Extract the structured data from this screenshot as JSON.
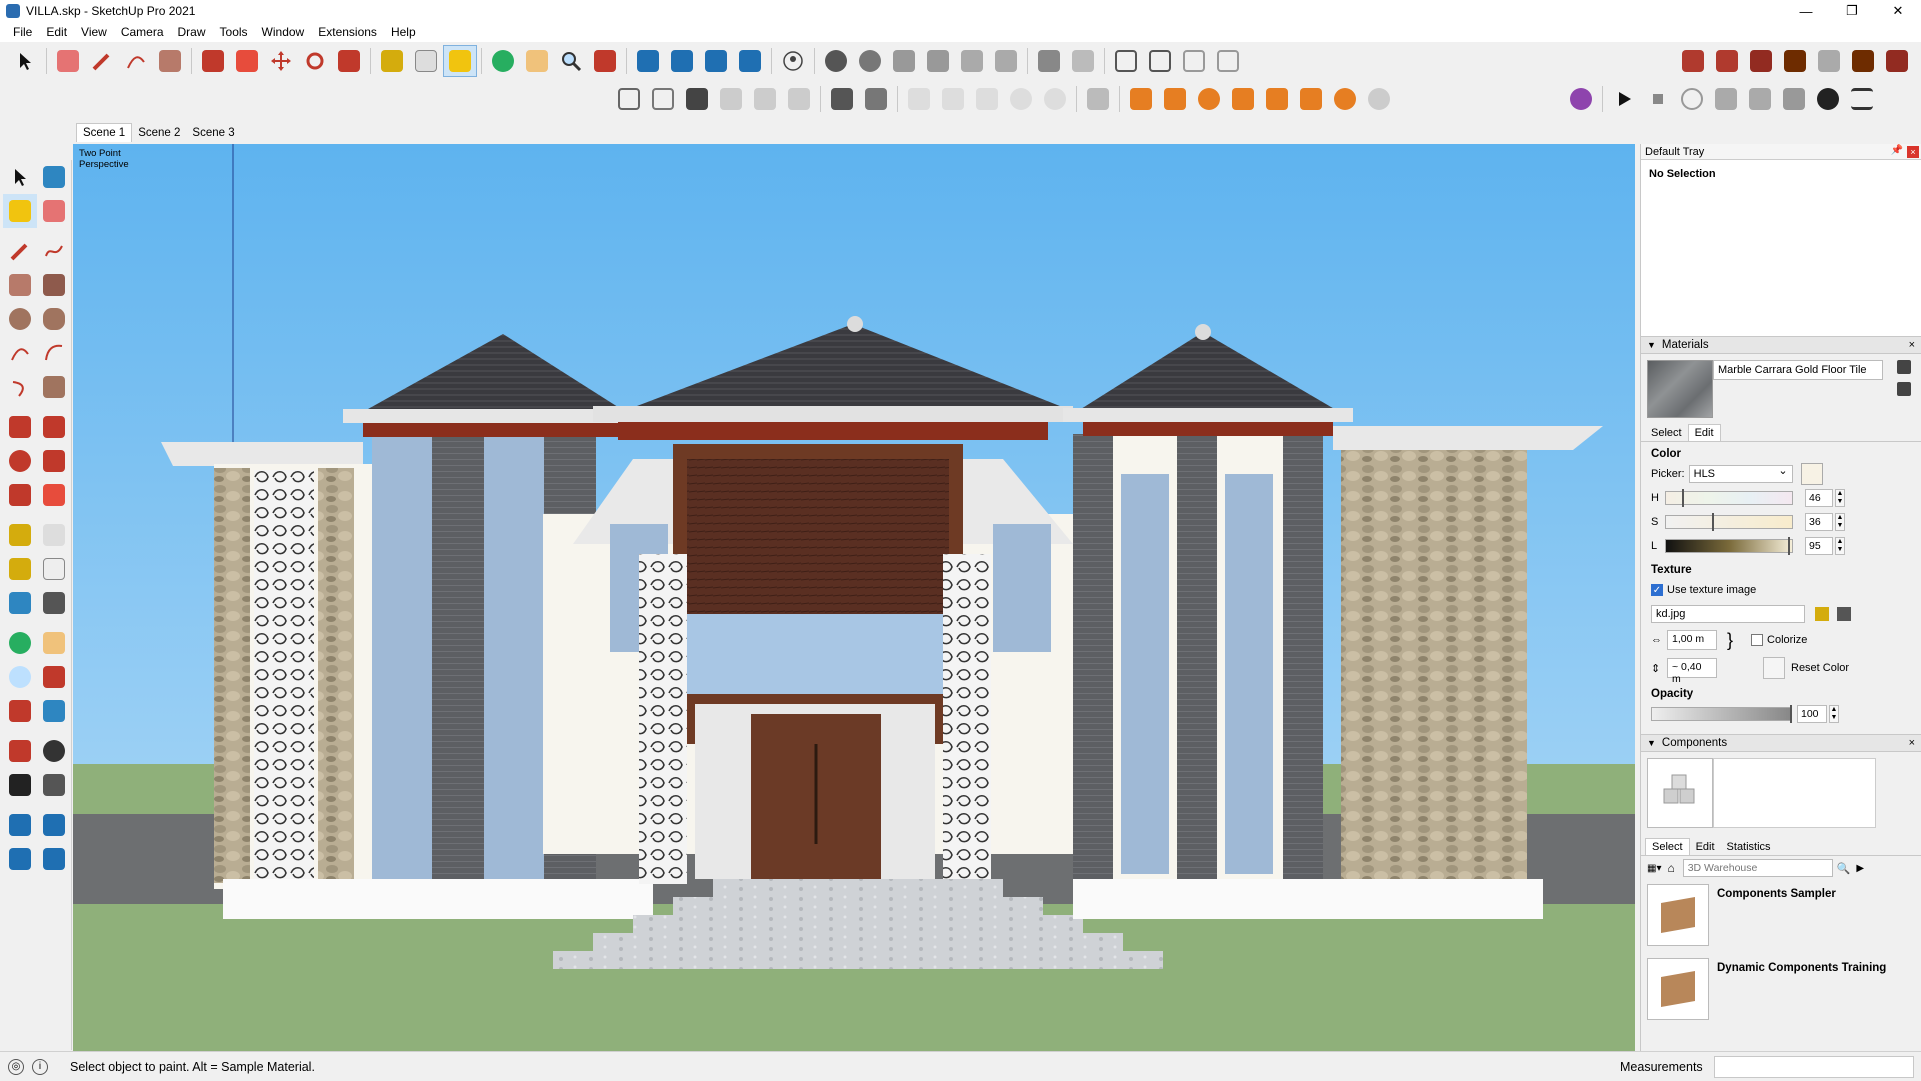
{
  "window": {
    "title": "VILLA.skp - SketchUp Pro 2021",
    "minimize": "—",
    "maximize": "❐",
    "close": "✕"
  },
  "menu": [
    "File",
    "Edit",
    "View",
    "Camera",
    "Draw",
    "Tools",
    "Window",
    "Extensions",
    "Help"
  ],
  "scenes": [
    "Scene 1",
    "Scene 2",
    "Scene 3"
  ],
  "viewport": {
    "label_line1": "Two Point",
    "label_line2": "Perspective"
  },
  "tray": {
    "title": "Default Tray",
    "pin": "📌",
    "close": "×",
    "entity_info": {
      "status": "No Selection"
    },
    "materials": {
      "header": "Materials",
      "close": "×",
      "material_name": "Marble Carrara Gold Floor Tile",
      "tabs": [
        "Select",
        "Edit"
      ],
      "color_title": "Color",
      "picker_label": "Picker:",
      "picker_value": "HLS",
      "h_label": "H",
      "h_value": "46",
      "s_label": "S",
      "s_value": "36",
      "l_label": "L",
      "l_value": "95",
      "texture_title": "Texture",
      "use_texture_label": "Use texture image",
      "use_texture_checked": true,
      "texture_file": "kd.jpg",
      "width_value": "1,00 m",
      "height_value": "~ 0,40 m",
      "colorize_label": "Colorize",
      "colorize_checked": false,
      "reset_color_label": "Reset Color",
      "opacity_title": "Opacity",
      "opacity_value": "100"
    },
    "components": {
      "header": "Components",
      "close": "×",
      "tabs": [
        "Select",
        "Edit",
        "Statistics"
      ],
      "search_placeholder": "3D Warehouse",
      "items": [
        "Components Sampler",
        "Dynamic Components Training"
      ]
    }
  },
  "status": {
    "message": "Select object to paint. Alt = Sample Material.",
    "measurements_label": "Measurements"
  },
  "colors": {
    "sky": "#7fc6f5",
    "ground": "#8fb07a",
    "roof": "#3a3a3f",
    "accent": "#2d6fd1"
  }
}
